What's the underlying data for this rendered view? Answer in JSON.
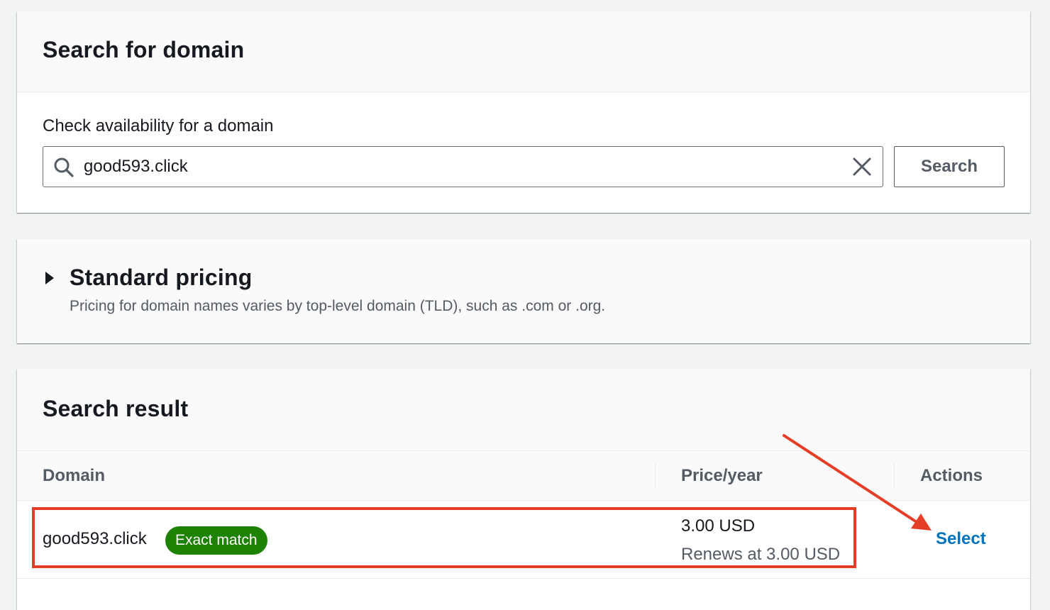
{
  "search_card": {
    "title": "Search for domain",
    "field_label": "Check availability for a domain",
    "input_value": "good593.click",
    "search_button": "Search"
  },
  "pricing_card": {
    "title": "Standard pricing",
    "description": "Pricing for domain names varies by top-level domain (TLD), such as .com or .org."
  },
  "result_card": {
    "title": "Search result",
    "columns": [
      "Domain",
      "Price/year",
      "Actions"
    ],
    "rows": [
      {
        "domain": "good593.click",
        "badge": "Exact match",
        "price": "3.00 USD",
        "renews": "Renews at 3.00 USD",
        "action": "Select"
      }
    ]
  },
  "colors": {
    "badge_green": "#1d8102",
    "link_blue": "#0073bb",
    "annotation_red": "#e53e26"
  },
  "icons": [
    "search-icon",
    "clear-icon",
    "caret-right-icon"
  ]
}
